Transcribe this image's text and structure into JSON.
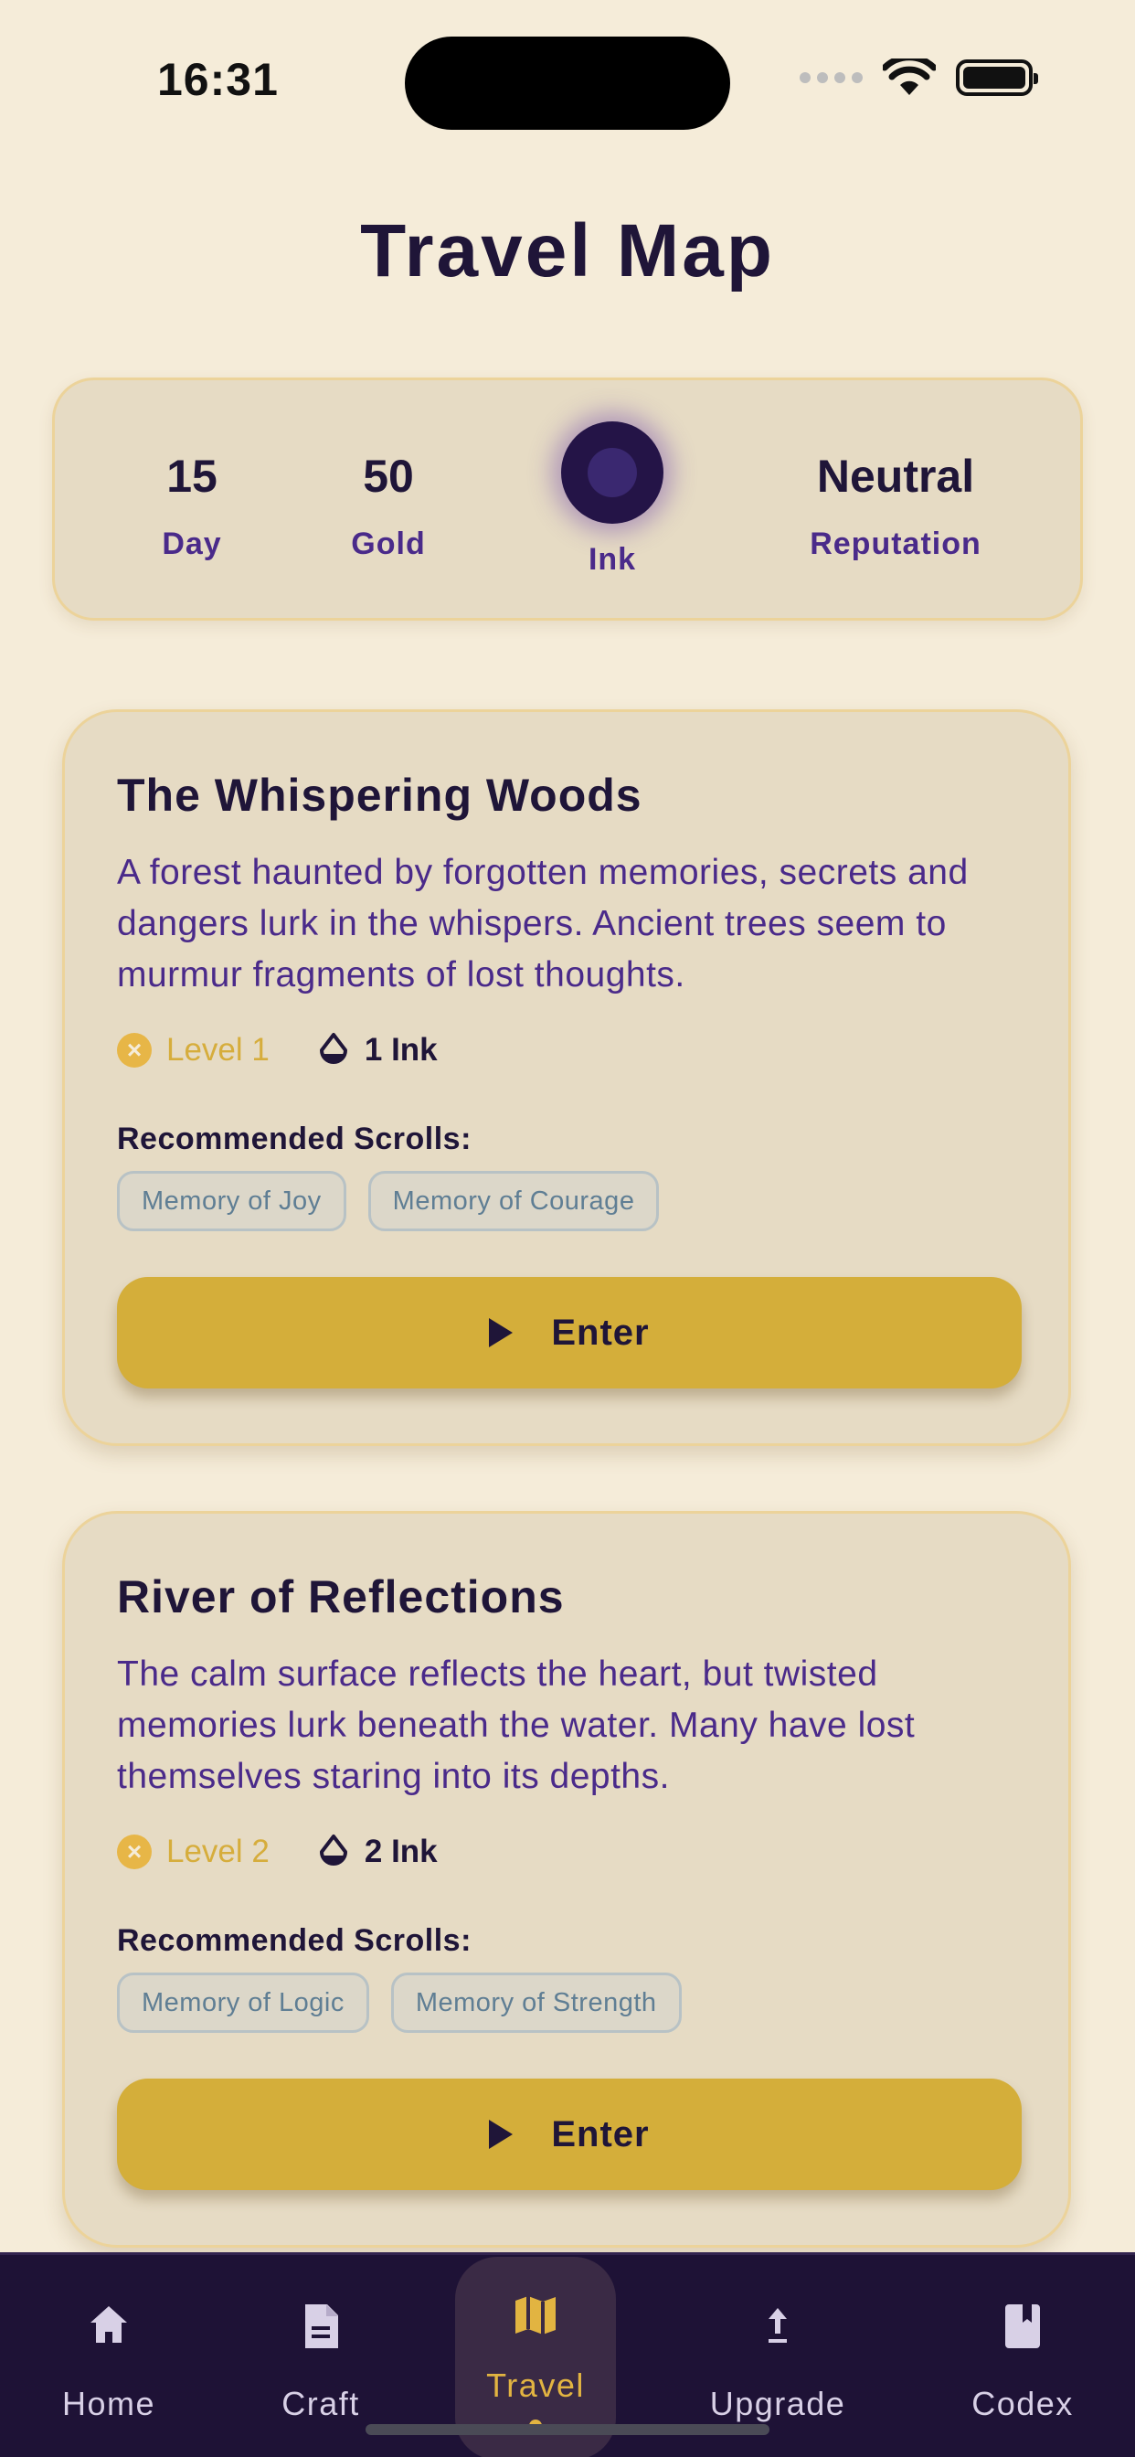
{
  "status_bar": {
    "time": "16:31"
  },
  "header": {
    "title": "Travel Map"
  },
  "stats": {
    "day": {
      "value": "15",
      "label": "Day"
    },
    "gold": {
      "value": "50",
      "label": "Gold"
    },
    "ink": {
      "label": "Ink"
    },
    "reputation": {
      "value": "Neutral",
      "label": "Reputation"
    }
  },
  "locations": [
    {
      "title": "The Whispering Woods",
      "description": "A forest haunted by forgotten memories, secrets and dangers lurk in the whispers. Ancient trees seem to murmur fragments of lost thoughts.",
      "level": "Level 1",
      "ink_cost": "1 Ink",
      "recommended_label": "Recommended Scrolls:",
      "scrolls": [
        "Memory of Joy",
        "Memory of Courage"
      ],
      "button_label": "Enter"
    },
    {
      "title": "River of Reflections",
      "description": "The calm surface reflects the heart, but twisted memories lurk beneath the water. Many have lost themselves staring into its depths.",
      "level": "Level 2",
      "ink_cost": "2 Ink",
      "recommended_label": "Recommended Scrolls:",
      "scrolls": [
        "Memory of Logic",
        "Memory of Strength"
      ],
      "button_label": "Enter"
    }
  ],
  "nav": {
    "items": [
      {
        "label": "Home",
        "icon": "home-icon"
      },
      {
        "label": "Craft",
        "icon": "document-icon"
      },
      {
        "label": "Travel",
        "icon": "map-icon",
        "active": true
      },
      {
        "label": "Upgrade",
        "icon": "upload-arrow-icon"
      },
      {
        "label": "Codex",
        "icon": "book-icon"
      }
    ]
  },
  "colors": {
    "background": "#f5ecd9",
    "card": "#e6dbc4",
    "accent_gold": "#d4ae3a",
    "ink_purple": "#4a2a8a",
    "nav_bg": "#1e1236"
  }
}
